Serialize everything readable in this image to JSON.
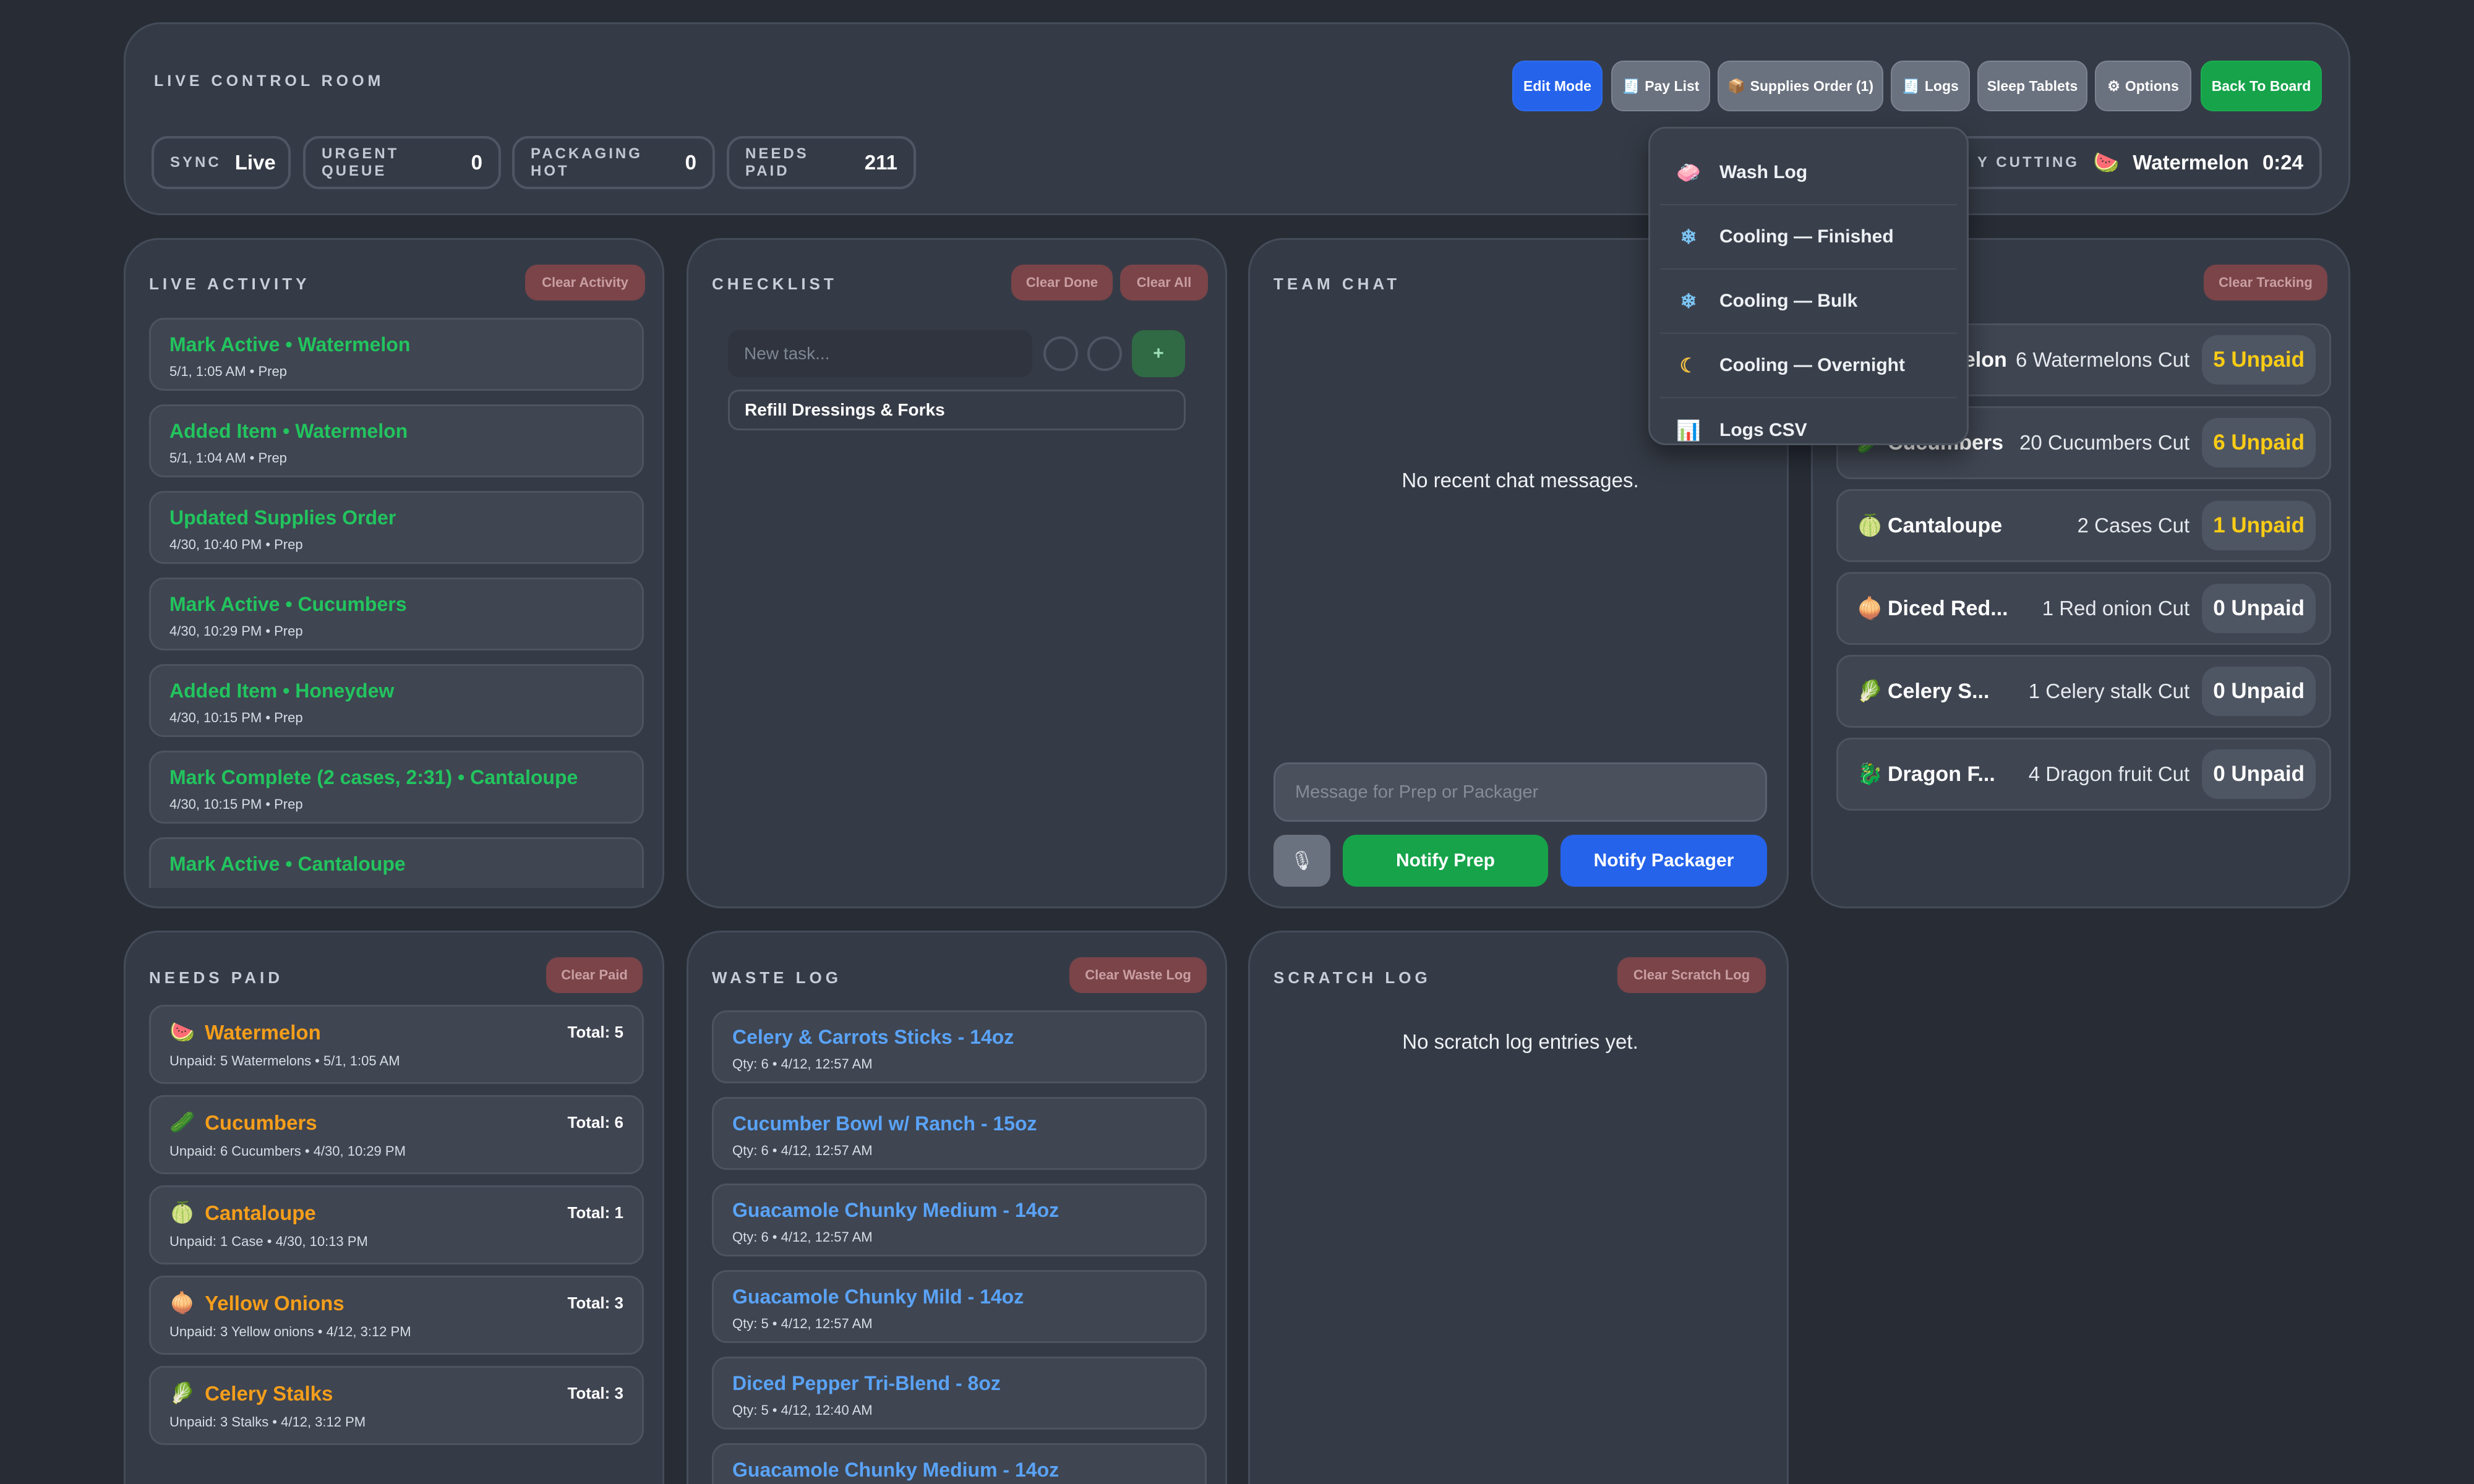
{
  "header": {
    "title": "LIVE CONTROL ROOM",
    "buttons": {
      "edit_mode": "Edit Mode",
      "pay_list": "Pay List",
      "supplies_order": "Supplies Order (1)",
      "logs": "Logs",
      "sleep_tablets": "Sleep Tablets",
      "options": "Options",
      "back_to_board": "Back To Board"
    },
    "pills": [
      {
        "label": "SYNC",
        "value": "Live"
      },
      {
        "label": "URGENT QUEUE",
        "value": "0"
      },
      {
        "label": "PACKAGING HOT",
        "value": "0"
      },
      {
        "label": "NEEDS PAID",
        "value": "211"
      }
    ],
    "cutting": {
      "label": "Y CUTTING",
      "item": "Watermelon",
      "time": "0:24"
    }
  },
  "logs_menu": {
    "items": [
      {
        "label": "Wash Log",
        "icon": "wash-icon"
      },
      {
        "label": "Cooling — Finished",
        "icon": "snowflake-icon"
      },
      {
        "label": "Cooling — Bulk",
        "icon": "snowflake-icon"
      },
      {
        "label": "Cooling — Overnight",
        "icon": "moon-icon"
      },
      {
        "label": "Logs CSV",
        "icon": "chart-icon"
      }
    ]
  },
  "activity": {
    "title": "LIVE ACTIVITY",
    "clear_label": "Clear Activity",
    "items": [
      {
        "title": "Mark Active • Watermelon",
        "meta": "5/1, 1:05 AM • Prep"
      },
      {
        "title": "Added Item • Watermelon",
        "meta": "5/1, 1:04 AM • Prep"
      },
      {
        "title": "Updated Supplies Order",
        "meta": "4/30, 10:40 PM • Prep"
      },
      {
        "title": "Mark Active • Cucumbers",
        "meta": "4/30, 10:29 PM • Prep"
      },
      {
        "title": "Added Item • Honeydew",
        "meta": "4/30, 10:15 PM • Prep"
      },
      {
        "title": "Mark Complete (2 cases, 2:31) • Cantaloupe",
        "meta": "4/30, 10:15 PM • Prep"
      },
      {
        "title": "Mark Active • Cantaloupe",
        "meta": ""
      }
    ]
  },
  "checklist": {
    "title": "CHECKLIST",
    "clear_done_label": "Clear Done",
    "clear_all_label": "Clear All",
    "input_placeholder": "New task...",
    "add_label": "+",
    "tasks": [
      "Refill Dressings & Forks"
    ]
  },
  "team_chat": {
    "title": "TEAM CHAT",
    "empty_text": "No recent chat messages.",
    "input_placeholder": "Message for Prep or Packager",
    "notify_prep": "Notify Prep",
    "notify_packager": "Notify Packager"
  },
  "tracking": {
    "clear_label": "Clear Tracking",
    "rows": [
      {
        "icon": "🍉",
        "name": "Watermelon",
        "cut": "6 Watermelons Cut",
        "unpaid": "5 Unpaid",
        "highlight": true
      },
      {
        "icon": "🥒",
        "name": "Cucumbers",
        "cut": "20 Cucumbers Cut",
        "unpaid": "6 Unpaid",
        "highlight": true
      },
      {
        "icon": "🍈",
        "name": "Cantaloupe",
        "cut": "2 Cases Cut",
        "unpaid": "1 Unpaid",
        "highlight": true
      },
      {
        "icon": "🧅",
        "name": "Diced Red...",
        "cut": "1 Red onion Cut",
        "unpaid": "0 Unpaid",
        "highlight": false
      },
      {
        "icon": "🥬",
        "name": "Celery S...",
        "cut": "1 Celery stalk Cut",
        "unpaid": "0 Unpaid",
        "highlight": false
      },
      {
        "icon": "🐉",
        "name": "Dragon F...",
        "cut": "4 Dragon fruit Cut",
        "unpaid": "0 Unpaid",
        "highlight": false
      }
    ]
  },
  "needs_paid": {
    "title": "NEEDS PAID",
    "clear_label": "Clear Paid",
    "items": [
      {
        "icon": "🍉",
        "name": "Watermelon",
        "total": "Total: 5",
        "meta": "Unpaid: 5 Watermelons • 5/1, 1:05 AM"
      },
      {
        "icon": "🥒",
        "name": "Cucumbers",
        "total": "Total: 6",
        "meta": "Unpaid: 6 Cucumbers • 4/30, 10:29 PM"
      },
      {
        "icon": "🍈",
        "name": "Cantaloupe",
        "total": "Total: 1",
        "meta": "Unpaid: 1 Case • 4/30, 10:13 PM"
      },
      {
        "icon": "🧅",
        "name": "Yellow Onions",
        "total": "Total: 3",
        "meta": "Unpaid: 3 Yellow onions • 4/12, 3:12 PM"
      },
      {
        "icon": "🥬",
        "name": "Celery Stalks",
        "total": "Total: 3",
        "meta": "Unpaid: 3 Stalks • 4/12, 3:12 PM"
      }
    ]
  },
  "waste_log": {
    "title": "WASTE LOG",
    "clear_label": "Clear Waste Log",
    "items": [
      {
        "title": "Celery & Carrots Sticks - 14oz",
        "meta": "Qty: 6 • 4/12, 12:57 AM"
      },
      {
        "title": "Cucumber Bowl w/ Ranch - 15oz",
        "meta": "Qty: 6 • 4/12, 12:57 AM"
      },
      {
        "title": "Guacamole Chunky Medium - 14oz",
        "meta": "Qty: 6 • 4/12, 12:57 AM"
      },
      {
        "title": "Guacamole Chunky Mild - 14oz",
        "meta": "Qty: 5 • 4/12, 12:57 AM"
      },
      {
        "title": "Diced Pepper Tri-Blend - 8oz",
        "meta": "Qty: 5 • 4/12, 12:40 AM"
      },
      {
        "title": "Guacamole Chunky Medium - 14oz",
        "meta": ""
      }
    ]
  },
  "scratch_log": {
    "title": "SCRATCH LOG",
    "clear_label": "Clear Scratch Log",
    "empty_text": "No scratch log entries yet."
  },
  "colors": {
    "blue": "#2563eb",
    "green": "#16a34a",
    "activity_green": "#22c45e",
    "waste_blue": "#5aa3f7",
    "needs_orange": "#f59e1b",
    "unpaid_yellow": "#facc15"
  }
}
